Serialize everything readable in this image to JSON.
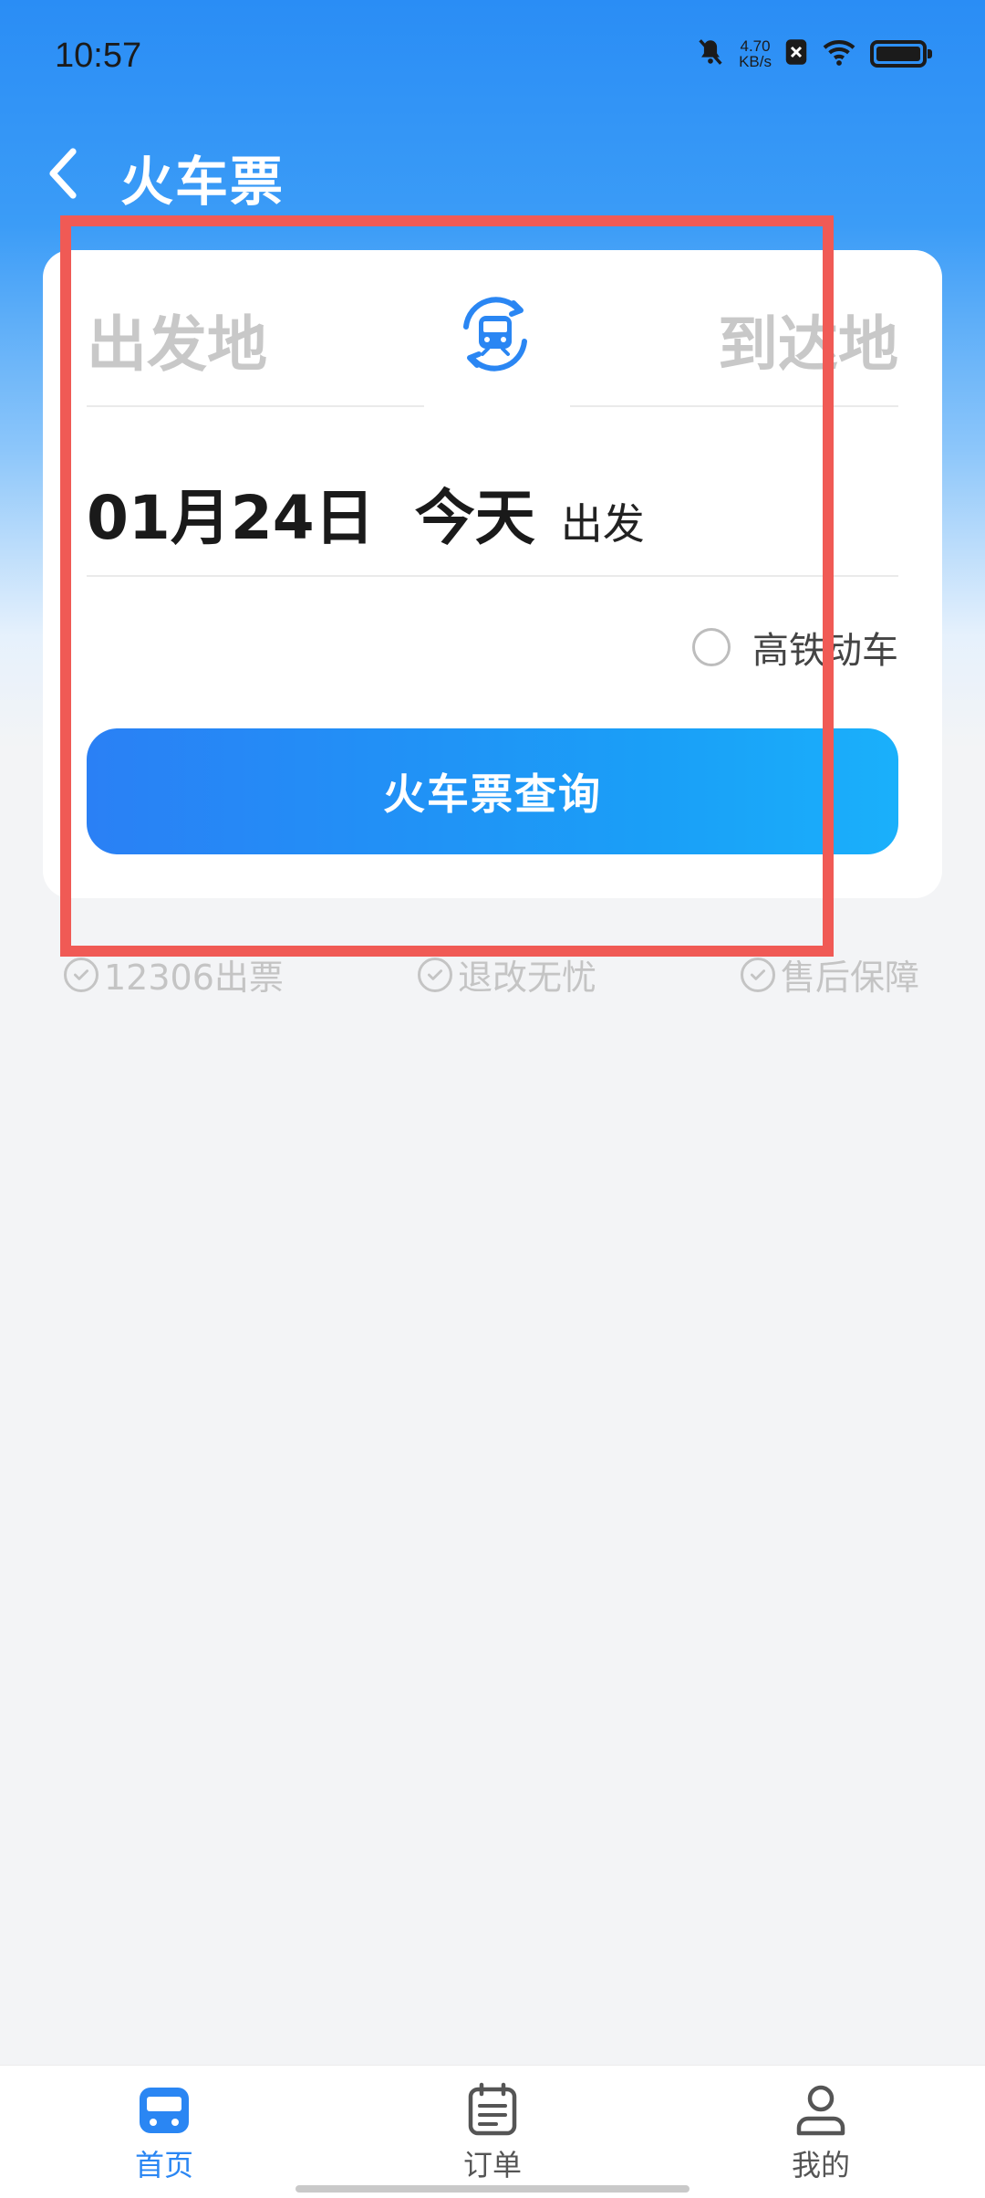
{
  "status_bar": {
    "time": "10:57",
    "speed_value": "4.70",
    "speed_unit": "KB/s",
    "icons": [
      "mute-icon",
      "sim-icon",
      "wifi-icon",
      "battery-icon"
    ]
  },
  "header": {
    "title": "火车票",
    "back_icon": "chevron-left-icon"
  },
  "search_card": {
    "from_placeholder": "出发地",
    "to_placeholder": "到达地",
    "swap_icon": "train-swap-icon",
    "date": "01月24日",
    "day": "今天",
    "depart_label": "出发",
    "high_speed_option": "高铁动车",
    "high_speed_checked": false,
    "search_button": "火车票查询"
  },
  "guarantees": [
    {
      "label": "12306出票"
    },
    {
      "label": "退改无忧"
    },
    {
      "label": "售后保障"
    }
  ],
  "bottom_nav": {
    "items": [
      {
        "label": "首页",
        "icon": "train-icon",
        "active": true
      },
      {
        "label": "订单",
        "icon": "orders-icon",
        "active": false
      },
      {
        "label": "我的",
        "icon": "user-icon",
        "active": false
      }
    ]
  },
  "colors": {
    "primary": "#2a80f5",
    "highlight_border": "#f05a55",
    "placeholder": "#c8c8c8",
    "inactive_nav": "#666666"
  }
}
